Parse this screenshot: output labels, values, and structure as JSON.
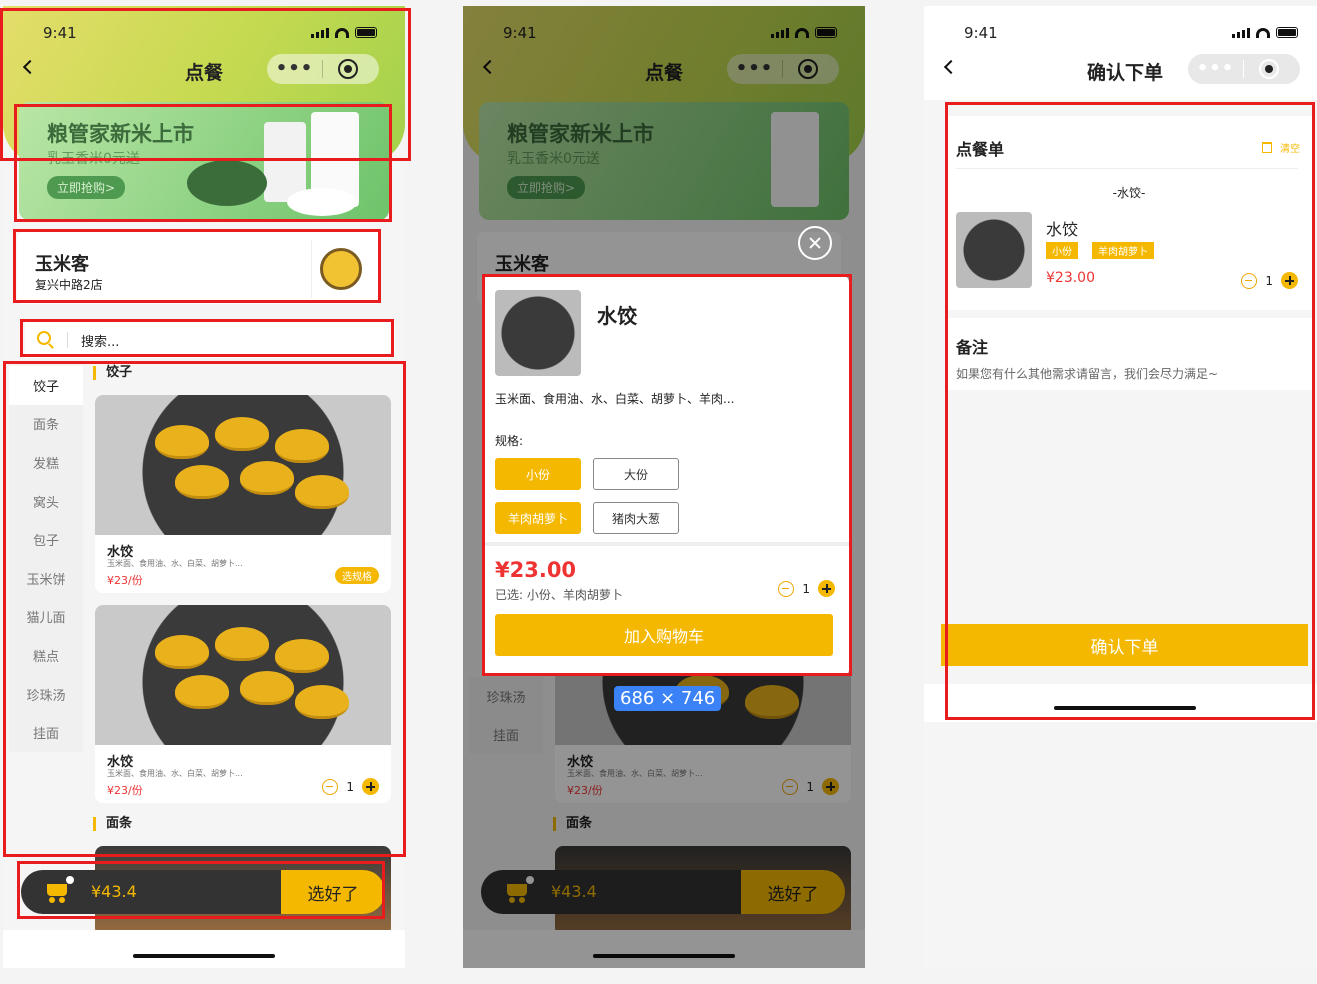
{
  "status": {
    "time": "9:41"
  },
  "screen1": {
    "nav_title": "点餐",
    "capsule_more": "•••",
    "banner": {
      "title": "粮管家新米上市",
      "subtitle": "乳玉香米0元送",
      "button": "立即抢购>"
    },
    "store": {
      "name": "玉米客",
      "address": "复兴中路2店"
    },
    "search_placeholder": "搜索...",
    "categories": [
      "饺子",
      "面条",
      "发糕",
      "窝头",
      "包子",
      "玉米饼",
      "猫儿面",
      "糕点",
      "珍珠汤",
      "挂面"
    ],
    "sections": {
      "dumplings": "饺子",
      "noodles": "面条"
    },
    "items": [
      {
        "name": "水饺",
        "desc": "玉米面、食用油、水、白菜、胡萝卜...",
        "price": "¥23/份",
        "action": "选规格"
      },
      {
        "name": "水饺",
        "desc": "玉米面、食用油、水、白菜、胡萝卜...",
        "price": "¥23/份",
        "qty": "1"
      }
    ],
    "cart": {
      "total": "¥43.4",
      "checkout": "选好了"
    }
  },
  "screen2": {
    "nav_title": "点餐",
    "background": {
      "banner": {
        "title": "粮管家新米上市",
        "subtitle": "乳玉香米0元送",
        "button": "立即抢购>"
      },
      "store_name": "玉米客",
      "categories": [
        "珍珠汤",
        "挂面"
      ],
      "item": {
        "name": "水饺",
        "desc": "玉米面、食用油、水、白菜、胡萝卜...",
        "price": "¥23/份",
        "qty": "1"
      },
      "section_noodles": "面条",
      "cart_total": "¥43.4",
      "checkout": "选好了"
    },
    "modal": {
      "title": "水饺",
      "ingredients": "玉米面、食用油、水、白菜、胡萝卜、羊肉...",
      "spec_label": "规格:",
      "sizes": [
        "小份",
        "大份"
      ],
      "fillings": [
        "羊肉胡萝卜",
        "猪肉大葱"
      ],
      "price": "¥23.00",
      "selected": "已选: 小份、羊肉胡萝卜",
      "qty": "1",
      "add_to_cart": "加入购物车"
    },
    "dimension_label": "686 × 746"
  },
  "screen3": {
    "nav_title": "确认下单",
    "order": {
      "title": "点餐单",
      "clear": "清空",
      "group": "-水饺-",
      "item_name": "水饺",
      "tags": [
        "小份",
        "羊肉胡萝卜"
      ],
      "price": "¥23.00",
      "qty": "1"
    },
    "note": {
      "title": "备注",
      "text": "如果您有什么其他需求请留言，我们会尽力满足~"
    },
    "confirm": "确认下单"
  },
  "colors": {
    "accent": "#f5b800",
    "price": "#e33333",
    "highlight_box": "#e81c1c",
    "dark_bar": "#333333"
  }
}
